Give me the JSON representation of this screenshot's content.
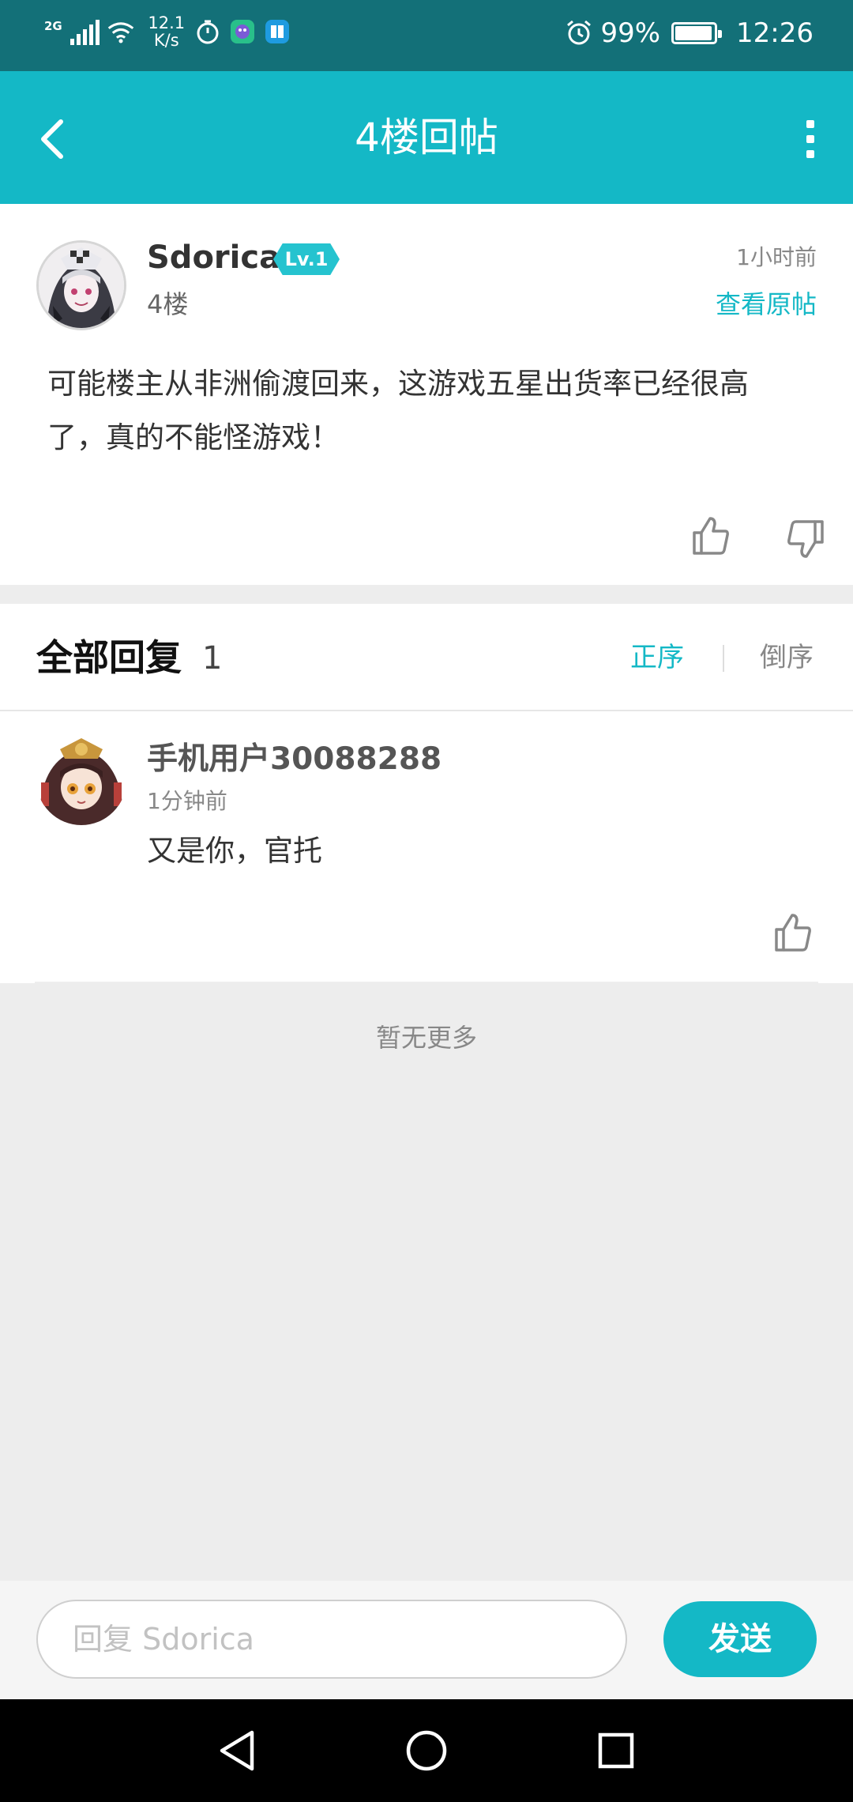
{
  "status_bar": {
    "network": "2G",
    "net_speed_value": "12.1",
    "net_speed_unit": "K/s",
    "battery": "99%",
    "time": "12:26"
  },
  "header": {
    "title": "4楼回帖"
  },
  "post": {
    "author": "Sdorica",
    "level": "Lv.1",
    "floor": "4楼",
    "time": "1小时前",
    "view_original": "查看原帖",
    "content": "可能楼主从非洲偷渡回来，这游戏五星出货率已经很高了，真的不能怪游戏！"
  },
  "replies": {
    "title": "全部回复",
    "count": "1",
    "sort_asc": "正序",
    "sort_desc": "倒序",
    "items": [
      {
        "author": "手机用户30088288",
        "time": "1分钟前",
        "content": "又是你，官托"
      }
    ],
    "no_more": "暂无更多"
  },
  "reply_bar": {
    "placeholder": "回复 Sdorica",
    "send_label": "发送"
  },
  "colors": {
    "accent": "#14b8c6",
    "status_bar": "#137078",
    "background": "#ededed"
  },
  "icons": [
    "back-arrow-icon",
    "more-vertical-icon",
    "thumb-up-icon",
    "thumb-down-icon",
    "alarm-icon",
    "wifi-icon",
    "timer-icon",
    "nav-back-icon",
    "nav-home-icon",
    "nav-recents-icon"
  ]
}
